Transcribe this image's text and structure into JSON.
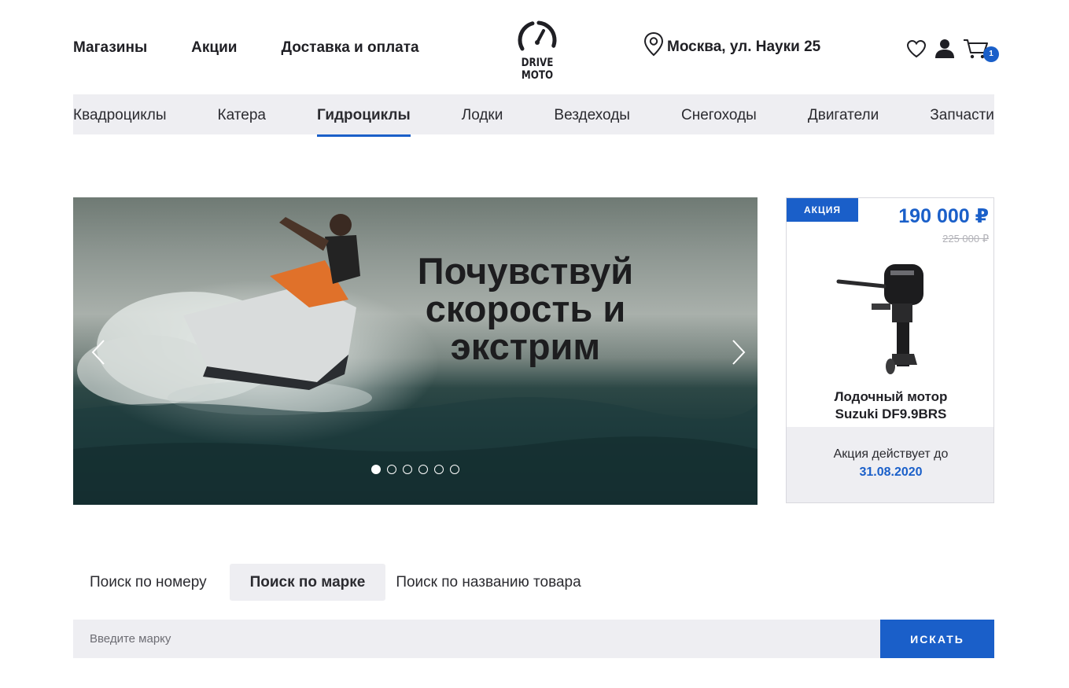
{
  "header": {
    "nav": [
      {
        "label": "Магазины"
      },
      {
        "label": "Акции"
      },
      {
        "label": "Доставка и оплата"
      }
    ],
    "logo_text": "DRIVE MOTO",
    "address": "Москва,  ул. Науки  25",
    "cart_count": "1",
    "icons": [
      "map-pin-icon",
      "heart-icon",
      "user-icon",
      "cart-icon"
    ]
  },
  "categories": [
    {
      "label": "Квадроциклы",
      "active": false
    },
    {
      "label": "Катера",
      "active": false
    },
    {
      "label": "Гидроциклы",
      "active": true
    },
    {
      "label": "Лодки",
      "active": false
    },
    {
      "label": "Вездеходы",
      "active": false
    },
    {
      "label": "Снегоходы",
      "active": false
    },
    {
      "label": "Двигатели",
      "active": false
    },
    {
      "label": "Запчасти",
      "active": false
    }
  ],
  "hero": {
    "title_line1": "Почувствуй",
    "title_line2": "скорость и",
    "title_line3": "экстрим",
    "slide_count": 6,
    "active_slide": 1
  },
  "promo": {
    "badge": "АКЦИЯ",
    "price": "190 000 ₽",
    "old_price": "225 000  ₽",
    "name_line1": "Лодочный мотор",
    "name_line2": "Suzuki DF9.9BRS",
    "valid_label": "Акция действует до",
    "valid_date": "31.08.2020"
  },
  "search": {
    "tabs": [
      {
        "label": "Поиск по  номеру",
        "active": false
      },
      {
        "label": "Поиск по марке",
        "active": true
      },
      {
        "label": "Поиск по названию товара",
        "active": false
      }
    ],
    "placeholder": "Введите марку",
    "button_label": "ИСКАТЬ"
  },
  "colors": {
    "accent": "#1a5fc9",
    "light_bg": "#eeeef2",
    "text": "#1f1f24"
  }
}
